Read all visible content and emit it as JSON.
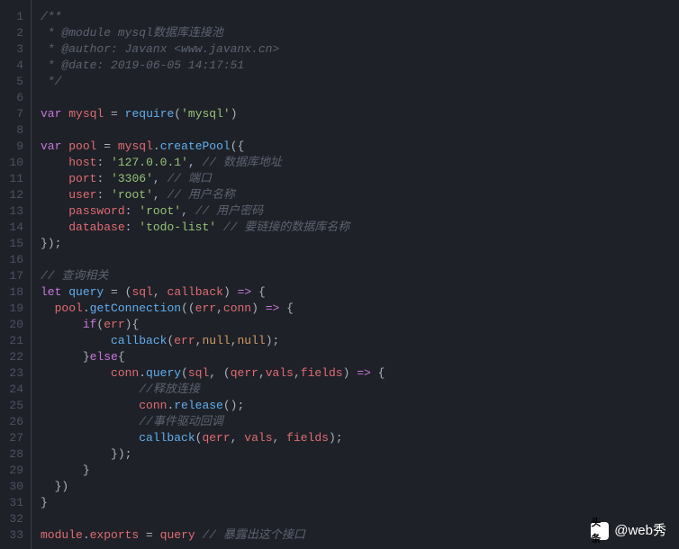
{
  "lines": [
    {
      "n": 1,
      "html": "<span class='c-cmt'>/**</span>"
    },
    {
      "n": 2,
      "html": "<span class='c-cmt'> * @module mysql数据库连接池</span>"
    },
    {
      "n": 3,
      "html": "<span class='c-cmt'> * @author: Javanx &lt;www.javanx.cn&gt;</span>"
    },
    {
      "n": 4,
      "html": "<span class='c-cmt'> * @date: 2019-06-05 14:17:51</span>"
    },
    {
      "n": 5,
      "html": "<span class='c-cmt'> */</span>"
    },
    {
      "n": 6,
      "html": ""
    },
    {
      "n": 7,
      "html": "<span class='c-kw'>var</span> <span class='c-prop'>mysql</span> <span class='c-op'>=</span> <span class='c-fn'>require</span><span class='c-punct'>(</span><span class='c-str'>'mysql'</span><span class='c-punct'>)</span>"
    },
    {
      "n": 8,
      "html": ""
    },
    {
      "n": 9,
      "html": "<span class='c-kw'>var</span> <span class='c-prop'>pool</span> <span class='c-op'>=</span> <span class='c-prop'>mysql</span><span class='c-punct'>.</span><span class='c-fn'>createPool</span><span class='c-punct'>({</span>"
    },
    {
      "n": 10,
      "html": "    <span class='c-prop'>host</span><span class='c-punct'>:</span> <span class='c-str'>'127.0.0.1'</span><span class='c-punct'>,</span> <span class='c-cmt'>// 数据库地址</span>"
    },
    {
      "n": 11,
      "html": "    <span class='c-prop'>port</span><span class='c-punct'>:</span> <span class='c-str'>'3306'</span><span class='c-punct'>,</span> <span class='c-cmt'>// 端口</span>"
    },
    {
      "n": 12,
      "html": "    <span class='c-prop'>user</span><span class='c-punct'>:</span> <span class='c-str'>'root'</span><span class='c-punct'>,</span> <span class='c-cmt'>// 用户名称</span>"
    },
    {
      "n": 13,
      "html": "    <span class='c-prop'>password</span><span class='c-punct'>:</span> <span class='c-str'>'root'</span><span class='c-punct'>,</span> <span class='c-cmt'>// 用户密码</span>"
    },
    {
      "n": 14,
      "html": "    <span class='c-prop'>database</span><span class='c-punct'>:</span> <span class='c-str'>'todo-list'</span> <span class='c-cmt'>// 要链接的数据库名称</span>"
    },
    {
      "n": 15,
      "html": "<span class='c-punct'>});</span>"
    },
    {
      "n": 16,
      "html": ""
    },
    {
      "n": 17,
      "html": "<span class='c-cmt'>// 查询相关</span>"
    },
    {
      "n": 18,
      "html": "<span class='c-kw'>let</span> <span class='c-fn'>query</span> <span class='c-op'>=</span> <span class='c-punct'>(</span><span class='c-prop'>sql</span><span class='c-punct'>,</span> <span class='c-prop'>callback</span><span class='c-punct'>)</span> <span class='c-kw'>=&gt;</span> <span class='c-punct'>{</span>"
    },
    {
      "n": 19,
      "html": "  <span class='c-prop'>pool</span><span class='c-punct'>.</span><span class='c-fn'>getConnection</span><span class='c-punct'>((</span><span class='c-prop'>err</span><span class='c-punct'>,</span><span class='c-prop'>conn</span><span class='c-punct'>)</span> <span class='c-kw'>=&gt;</span> <span class='c-punct'>{</span>"
    },
    {
      "n": 20,
      "html": "      <span class='c-kw'>if</span><span class='c-punct'>(</span><span class='c-prop'>err</span><span class='c-punct'>){</span>"
    },
    {
      "n": 21,
      "html": "          <span class='c-fn'>callback</span><span class='c-punct'>(</span><span class='c-prop'>err</span><span class='c-punct'>,</span><span class='c-const'>null</span><span class='c-punct'>,</span><span class='c-const'>null</span><span class='c-punct'>);</span>"
    },
    {
      "n": 22,
      "html": "      <span class='c-punct'>}</span><span class='c-kw'>else</span><span class='c-punct'>{</span>"
    },
    {
      "n": 23,
      "html": "          <span class='c-prop'>conn</span><span class='c-punct'>.</span><span class='c-fn'>query</span><span class='c-punct'>(</span><span class='c-prop'>sql</span><span class='c-punct'>,</span> <span class='c-punct'>(</span><span class='c-prop'>qerr</span><span class='c-punct'>,</span><span class='c-prop'>vals</span><span class='c-punct'>,</span><span class='c-prop'>fields</span><span class='c-punct'>)</span> <span class='c-kw'>=&gt;</span> <span class='c-punct'>{</span>"
    },
    {
      "n": 24,
      "html": "              <span class='c-cmt'>//释放连接</span>"
    },
    {
      "n": 25,
      "html": "              <span class='c-prop'>conn</span><span class='c-punct'>.</span><span class='c-fn'>release</span><span class='c-punct'>();</span>"
    },
    {
      "n": 26,
      "html": "              <span class='c-cmt'>//事件驱动回调</span>"
    },
    {
      "n": 27,
      "html": "              <span class='c-fn'>callback</span><span class='c-punct'>(</span><span class='c-prop'>qerr</span><span class='c-punct'>,</span> <span class='c-prop'>vals</span><span class='c-punct'>,</span> <span class='c-prop'>fields</span><span class='c-punct'>);</span>"
    },
    {
      "n": 28,
      "html": "          <span class='c-punct'>});</span>"
    },
    {
      "n": 29,
      "html": "      <span class='c-punct'>}</span>"
    },
    {
      "n": 30,
      "html": "  <span class='c-punct'>})</span>"
    },
    {
      "n": 31,
      "html": "<span class='c-punct'>}</span>"
    },
    {
      "n": 32,
      "html": ""
    },
    {
      "n": 33,
      "html": "<span class='c-prop'>module</span><span class='c-punct'>.</span><span class='c-prop'>exports</span> <span class='c-op'>=</span> <span class='c-prop'>query</span> <span class='c-cmt'>// 暴露出这个接口</span>"
    }
  ],
  "watermark": {
    "logo_text": "头条",
    "handle": "@web秀"
  }
}
